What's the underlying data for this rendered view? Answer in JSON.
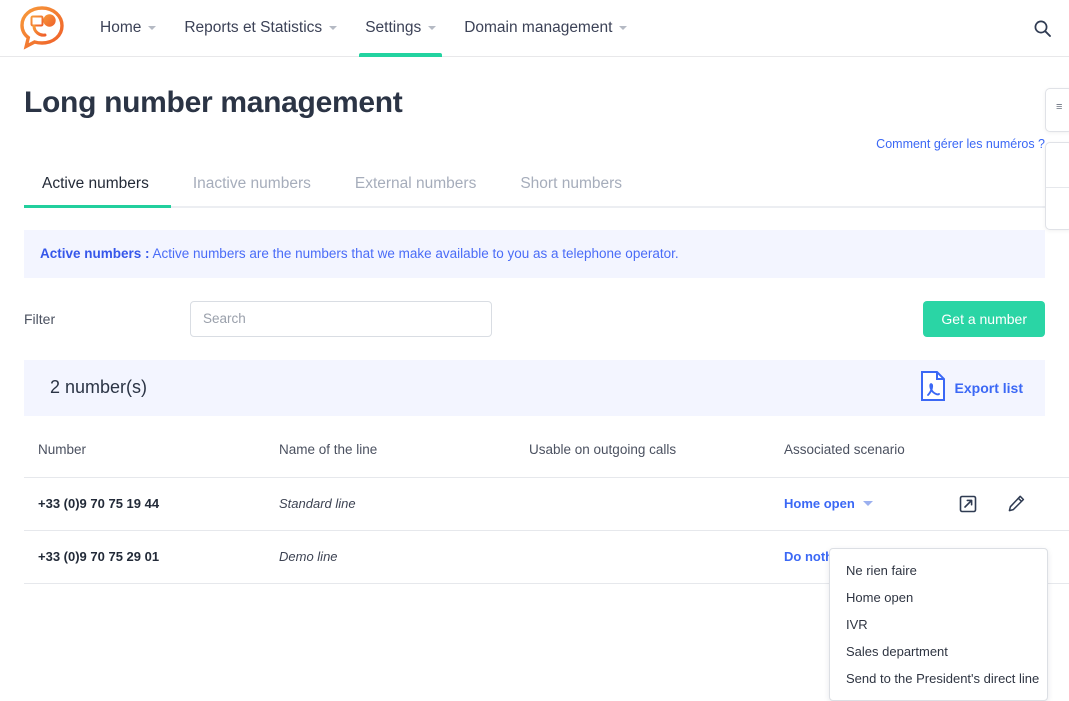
{
  "topnav": {
    "logo_name": "telephony-logo",
    "items": [
      {
        "label": "Home",
        "has_caret": true,
        "active": false
      },
      {
        "label": "Reports et Statistics",
        "has_caret": true,
        "active": false
      },
      {
        "label": "Settings",
        "has_caret": true,
        "active": true
      },
      {
        "label": "Domain management",
        "has_caret": true,
        "active": false
      }
    ],
    "search_icon": "search-icon"
  },
  "page": {
    "title": "Long number management",
    "help_link": "Comment gérer les numéros ?"
  },
  "tabs": [
    {
      "label": "Active numbers",
      "active": true
    },
    {
      "label": "Inactive numbers",
      "active": false
    },
    {
      "label": "External numbers",
      "active": false
    },
    {
      "label": "Short numbers",
      "active": false
    }
  ],
  "info_banner": {
    "strong": "Active numbers :",
    "text": " Active numbers are the numbers that we make available to you as a telephone operator."
  },
  "filter": {
    "label": "Filter",
    "search_placeholder": "Search",
    "search_value": "",
    "get_number_button": "Get a number"
  },
  "count_bar": {
    "count_text": "2 number(s)",
    "export_label": "Export list",
    "export_icon": "pdf-file-icon"
  },
  "table": {
    "headers": [
      "Number",
      "Name of the line",
      "Usable on outgoing calls",
      "Associated scenario",
      ""
    ],
    "rows": [
      {
        "number": "+33 (0)9 70 75 19 44",
        "line_name": "Standard line",
        "usable_outgoing": "",
        "scenario": "Home open",
        "scenario_open": false,
        "has_external_link": true,
        "has_edit": true
      },
      {
        "number": "+33 (0)9 70 75 29 01",
        "line_name": "Demo line",
        "usable_outgoing": "",
        "scenario": "Do nothing",
        "scenario_open": true,
        "has_external_link": false,
        "has_edit": true
      }
    ]
  },
  "scenario_dropdown": {
    "options": [
      "Ne rien faire",
      "Home open",
      "IVR",
      "Sales department",
      "Send to the President's direct line"
    ]
  },
  "colors": {
    "accent_green": "#22d3a0",
    "link_blue": "#3b68f5",
    "banner_bg": "#f3f5ff",
    "logo_orange": "#f4772e"
  }
}
